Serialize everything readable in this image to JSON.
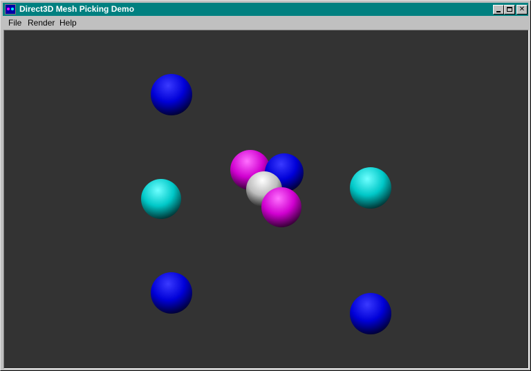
{
  "window": {
    "title": "Direct3D Mesh Picking Demo"
  },
  "icons": {
    "app": "app-icon",
    "minimize": "minimize-icon",
    "maximize": "maximize-icon",
    "close": "close-icon"
  },
  "menu": {
    "items": [
      "File",
      "Render",
      "Help"
    ]
  },
  "scene": {
    "background_color": "#333333",
    "colors": {
      "blue": "#0000ff",
      "cyan": "#00e6e6",
      "magenta": "#ff00ff",
      "white": "#e8e8e8"
    },
    "objects": [
      {
        "type": "sphere",
        "color": "blue"
      },
      {
        "type": "sphere",
        "color": "cyan"
      },
      {
        "type": "sphere",
        "color": "cyan"
      },
      {
        "type": "sphere",
        "color": "blue"
      },
      {
        "type": "sphere",
        "color": "blue"
      },
      {
        "type": "sphere",
        "color": "magenta"
      },
      {
        "type": "sphere",
        "color": "blue"
      },
      {
        "type": "sphere",
        "color": "white"
      },
      {
        "type": "sphere",
        "color": "magenta"
      }
    ]
  }
}
